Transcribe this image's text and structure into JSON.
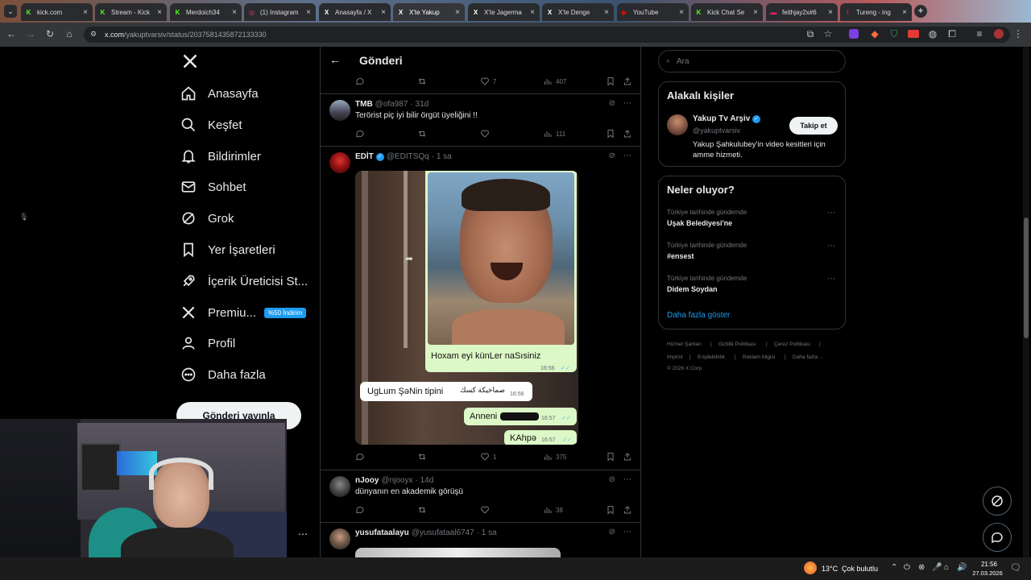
{
  "browser": {
    "tabs": [
      {
        "label": "kick.com",
        "fav": "K",
        "color": "#53fc18"
      },
      {
        "label": "Stream - Kick",
        "fav": "K",
        "color": "#53fc18"
      },
      {
        "label": "Merdoich34",
        "fav": "K",
        "color": "#53fc18"
      },
      {
        "label": "(1) Instagram",
        "fav": "◎",
        "color": "#e1306c"
      },
      {
        "label": "Anasayfa / X",
        "fav": "X",
        "color": "#ffffff"
      },
      {
        "label": "X'te Yakup",
        "fav": "X",
        "color": "#ffffff"
      },
      {
        "label": "X'te Jagerma",
        "fav": "X",
        "color": "#ffffff"
      },
      {
        "label": "X'te Denge",
        "fav": "X",
        "color": "#ffffff"
      },
      {
        "label": "YouTube",
        "fav": "▶",
        "color": "#ff0000"
      },
      {
        "label": "Kick Chat Se",
        "fav": "K",
        "color": "#53fc18"
      },
      {
        "label": "feithjay2x#6",
        "fav": "▬",
        "color": "#e91e63"
      },
      {
        "label": "Tureng - ing",
        "fav": "t",
        "color": "#c2185b"
      }
    ],
    "url_host": "x.com",
    "url_path": "/yakuptvarsiv/status/2037581435872133330"
  },
  "nav": {
    "items": [
      {
        "label": "Anasayfa",
        "icon": "home-icon"
      },
      {
        "label": "Keşfet",
        "icon": "search-icon"
      },
      {
        "label": "Bildirimler",
        "icon": "bell-icon"
      },
      {
        "label": "Sohbet",
        "icon": "mail-icon"
      },
      {
        "label": "Grok",
        "icon": "grok-icon"
      },
      {
        "label": "Yer İşaretleri",
        "icon": "bookmark-icon"
      },
      {
        "label": "İçerik Üreticisi St...",
        "icon": "rocket-icon"
      },
      {
        "label": "Premiu...",
        "icon": "x-icon"
      },
      {
        "label": "Profil",
        "icon": "person-icon"
      },
      {
        "label": "Daha fazla",
        "icon": "more-circle-icon"
      }
    ],
    "premium_badge": "%50 İndirim",
    "post_button": "Gönderi yayınla"
  },
  "header": {
    "title": "Gönderi"
  },
  "posts": {
    "top_actions": {
      "likes": "7",
      "views": "407"
    },
    "tmb": {
      "name": "TMB",
      "handle": "@ofa987",
      "time": "· 31d",
      "text": "Terörist piç iyi bilir örgüt üyeliğini !!",
      "views": "111"
    },
    "edit": {
      "name": "EDİT",
      "handle": "@EDITSQq",
      "time": "· 1 sa",
      "likes": "1",
      "views": "375",
      "image": {
        "msg1": "Hoxam eyi künLer naSısiniz",
        "msg1_time": "16:56",
        "msg2": "UgLum ŞəNin  tipini",
        "msg2_ar": "صماخيكة كسك",
        "msg2_time": "16:56",
        "msg3": "Anneni",
        "msg3_time": "16:57",
        "msg4": "KAhpə",
        "msg4_time": "16:57"
      }
    },
    "njooy": {
      "name": "nJooy",
      "handle": "@njooyx",
      "time": "· 14d",
      "text": "dünyanın en akademik görüşü",
      "views": "38"
    },
    "yusuf": {
      "name": "yusufataalayu",
      "handle": "@yusufataal6747",
      "time": "· 1 sa"
    }
  },
  "right": {
    "search_placeholder": "Ara",
    "related": {
      "title": "Alakalı kişiler",
      "name": "Yakup Tv Arşiv",
      "handle": "@yakuptvarsiv",
      "follow": "Takip et",
      "bio": "Yakup Şahkulubey'in video kesitleri için amme hizmeti."
    },
    "trends": {
      "title": "Neler oluyor?",
      "items": [
        {
          "category": "Türkiye tarihinde gündemde",
          "name": "Uşak Belediyesi'ne"
        },
        {
          "category": "Türkiye tarihinde gündemde",
          "name": "#ensest"
        },
        {
          "category": "Türkiye tarihinde gündemde",
          "name": "Didem Soydan"
        }
      ],
      "show_more": "Daha fazla göster"
    },
    "footer": {
      "links": [
        "Hizmet Şartları",
        "|",
        "Gizlilik Politikası",
        "|",
        "Çerez Politikası",
        "|",
        "Imprint",
        "|",
        "Erişilebilirlik",
        "|",
        "Reklam bilgisi",
        "|",
        "Daha fazla ..."
      ],
      "copyright": "© 2026 X Corp."
    }
  },
  "taskbar": {
    "weather_temp": "13°C",
    "weather_text": "Çok bulutlu",
    "time": "21:56",
    "date": "27.03.2026"
  }
}
